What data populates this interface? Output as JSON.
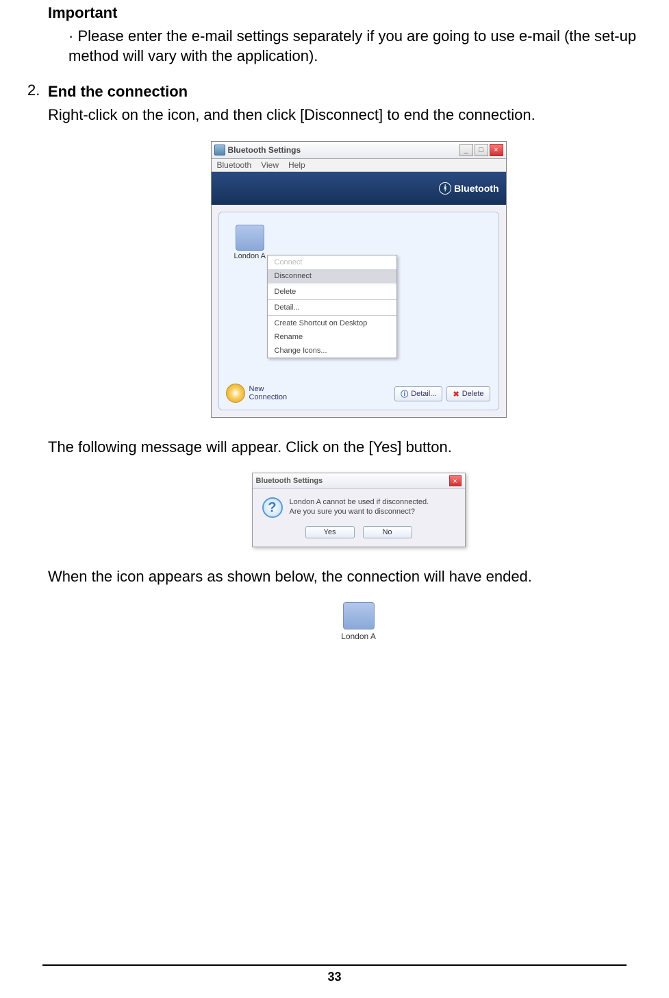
{
  "text": {
    "important_heading": "Important",
    "important_body": "Please enter the e-mail settings separately if you are going to use e-mail (the set-up method will vary with the application).",
    "step_num": "2.",
    "step_title": "End the connection",
    "step_instruction": "Right-click on the icon, and then click [Disconnect] to end the connection.",
    "after_win_msg": "The following message will appear. Click on the [Yes] button.",
    "after_dialog_msg": "When the icon appears as shown below, the connection will have ended."
  },
  "window": {
    "title": "Bluetooth Settings",
    "menu": {
      "bluetooth": "Bluetooth",
      "view": "View",
      "help": "Help"
    },
    "banner_logo": "Bluetooth",
    "device_label": "London A",
    "context_menu": {
      "connect": "Connect",
      "disconnect": "Disconnect",
      "delete": "Delete",
      "detail": "Detail...",
      "create_shortcut": "Create Shortcut on Desktop",
      "rename": "Rename",
      "change_icons": "Change Icons..."
    },
    "buttons": {
      "detail": "Detail...",
      "delete": "Delete"
    },
    "new_connection": {
      "line1": "New",
      "line2": "Connection"
    }
  },
  "dialog": {
    "title": "Bluetooth Settings",
    "msg_line1": "London A cannot be used if disconnected.",
    "msg_line2": "Are you sure you want to disconnect?",
    "yes": "Yes",
    "no": "No"
  },
  "final_icon_label": "London A",
  "page_number": "33"
}
